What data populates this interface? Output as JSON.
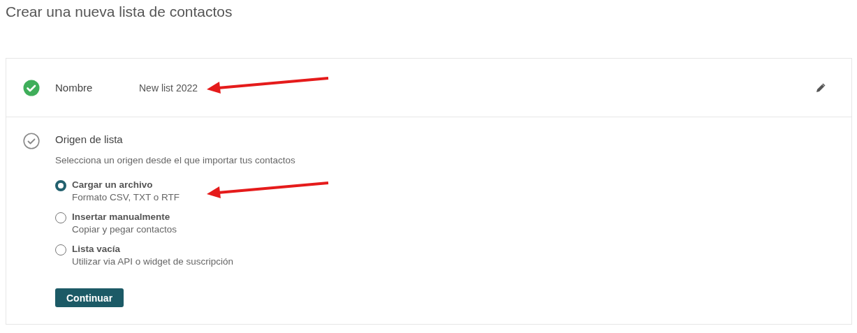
{
  "page": {
    "title": "Crear una nueva lista de contactos"
  },
  "steps": [
    {
      "kind": "summary",
      "completed": true,
      "label": "Nombre",
      "value": "New list 2022"
    },
    {
      "kind": "form",
      "completed": false,
      "label": "Origen de lista",
      "description": "Selecciona un origen desde el que importar tus contactos",
      "options": [
        {
          "label": "Cargar un archivo",
          "hint": "Formato CSV, TXT o RTF",
          "selected": true
        },
        {
          "label": "Insertar manualmente",
          "hint": "Copiar y pegar contactos",
          "selected": false
        },
        {
          "label": "Lista vacía",
          "hint": "Utilizar via API o widget de suscripción",
          "selected": false
        }
      ],
      "button": "Continuar"
    }
  ]
}
